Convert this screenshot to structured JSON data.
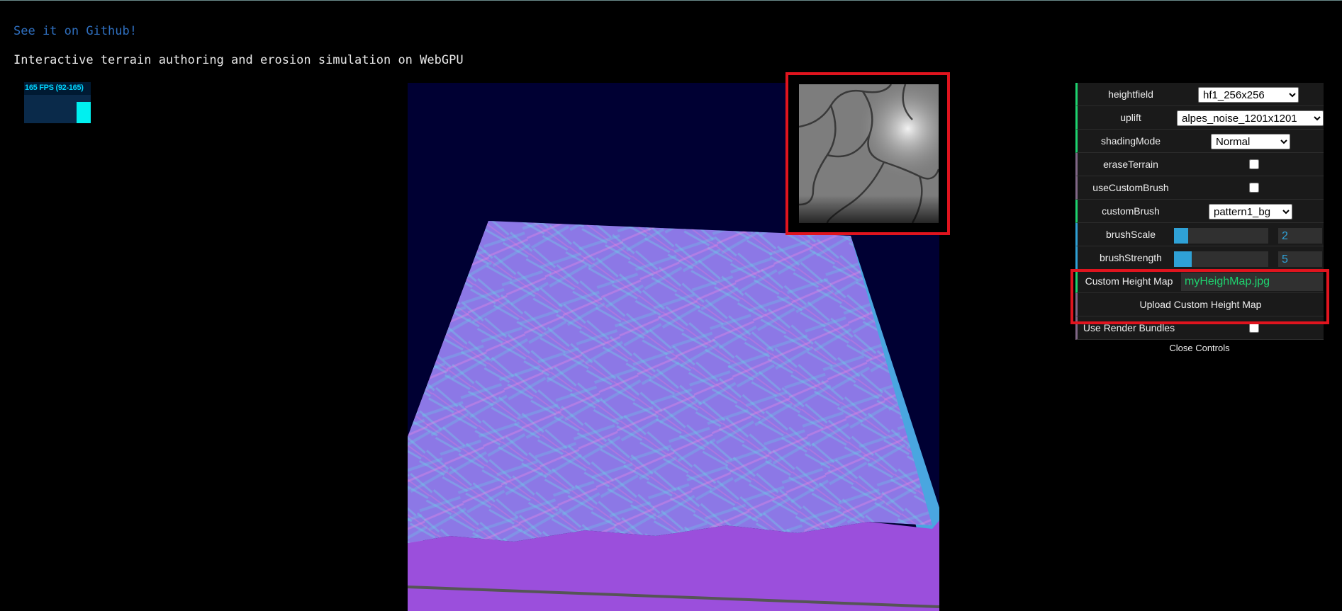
{
  "header": {
    "github_link": "See it on Github!",
    "subtitle": "Interactive terrain authoring and erosion simulation on WebGPU"
  },
  "fps_meter": {
    "label": "165 FPS (92-165)",
    "current_fraction": 0.75
  },
  "colors": {
    "link": "#2f6fbf",
    "slider_accent": "#2fa1d6",
    "string_value": "#1ed36f",
    "highlight_box": "#e0141e",
    "viewport_bg": "#000033",
    "terrain_top": "#8c78e6",
    "terrain_side": "#9b4fdc",
    "terrain_left_edge": "#d88ee0",
    "terrain_right_edge": "#4aa6e0"
  },
  "controls": {
    "heightfield": {
      "label": "heightfield",
      "value": "hf1_256x256",
      "options": [
        "hf1_256x256"
      ]
    },
    "uplift": {
      "label": "uplift",
      "value": "alpes_noise_1201x1201",
      "options": [
        "alpes_noise_1201x1201"
      ]
    },
    "shading_mode": {
      "label": "shadingMode",
      "value": "Normal",
      "options": [
        "Normal"
      ]
    },
    "erase_terrain": {
      "label": "eraseTerrain",
      "checked": false
    },
    "use_custom_brush": {
      "label": "useCustomBrush",
      "checked": false
    },
    "custom_brush": {
      "label": "customBrush",
      "value": "pattern1_bg",
      "options": [
        "pattern1_bg"
      ]
    },
    "brush_scale": {
      "label": "brushScale",
      "value": "2",
      "fraction": 0.15
    },
    "brush_strength": {
      "label": "brushStrength",
      "value": "5",
      "fraction": 0.19
    },
    "custom_height_map": {
      "label": "Custom Height Map",
      "value": "myHeighMap.jpg"
    },
    "upload_button": {
      "label": "Upload Custom Height Map"
    },
    "use_render_bundles": {
      "label": "Use Render Bundles",
      "checked": false
    },
    "close_controls": "Close Controls"
  }
}
